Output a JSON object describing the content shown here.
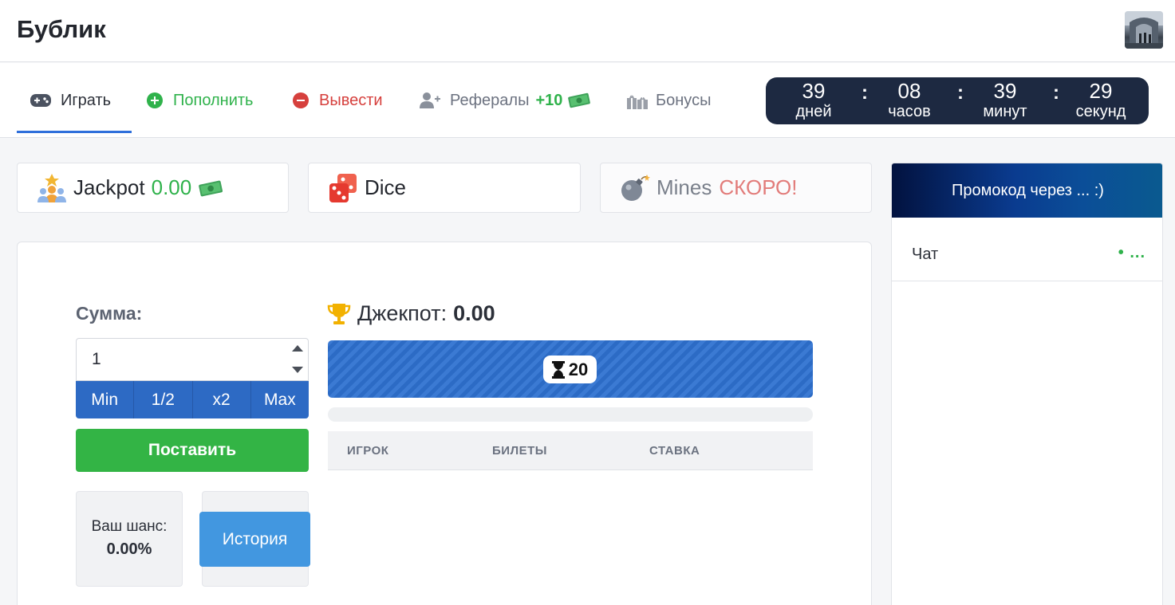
{
  "header": {
    "brand": "Бублик",
    "avatar_icon": "avatar-photo"
  },
  "nav": {
    "items": [
      {
        "label": "Играть",
        "icon": "gamepad-icon"
      },
      {
        "label": "Пополнить",
        "icon": "plus-circle-icon"
      },
      {
        "label": "Вывести",
        "icon": "minus-circle-icon"
      },
      {
        "label": "Рефералы",
        "icon": "user-plus-icon",
        "badge": "+10",
        "badge_icon": "money-icon"
      },
      {
        "label": "Бонусы",
        "icon": "gifts-icon"
      }
    ],
    "active_index": 0
  },
  "countdown": {
    "days": "39",
    "days_label": "дней",
    "hours": "08",
    "hours_label": "часов",
    "minutes": "39",
    "minutes_label": "минут",
    "seconds": "29",
    "seconds_label": "секунд",
    "separator": ":"
  },
  "games": [
    {
      "name": "Jackpot",
      "value": "0.00",
      "icon": "jackpot-icon",
      "extra_icon": "money-icon"
    },
    {
      "name": "Dice",
      "icon": "dice-icon"
    },
    {
      "name": "Mines",
      "badge": "СКОРО!",
      "icon": "bomb-icon"
    }
  ],
  "bet": {
    "sum_label": "Сумма:",
    "sum_value": "1",
    "quick_buttons": [
      "Min",
      "1/2",
      "x2",
      "Max"
    ],
    "place_label": "Поставить",
    "chance_label": "Ваш шанс:",
    "chance_value": "0.00%",
    "history_label": "История"
  },
  "jackpot": {
    "title": "Джекпот:",
    "amount": "0.00",
    "timer": "20",
    "progress": 0,
    "columns": [
      "ИГРОК",
      "БИЛЕТЫ",
      "СТАВКА"
    ]
  },
  "sidebar": {
    "promo": "Промокод через ... :)",
    "chat_title": "Чат",
    "chat_status": "• ..."
  },
  "colors": {
    "accent": "#2f6fdb",
    "green": "#2fb24b",
    "red": "#d6403d",
    "timer_bg": "#1d2941"
  }
}
